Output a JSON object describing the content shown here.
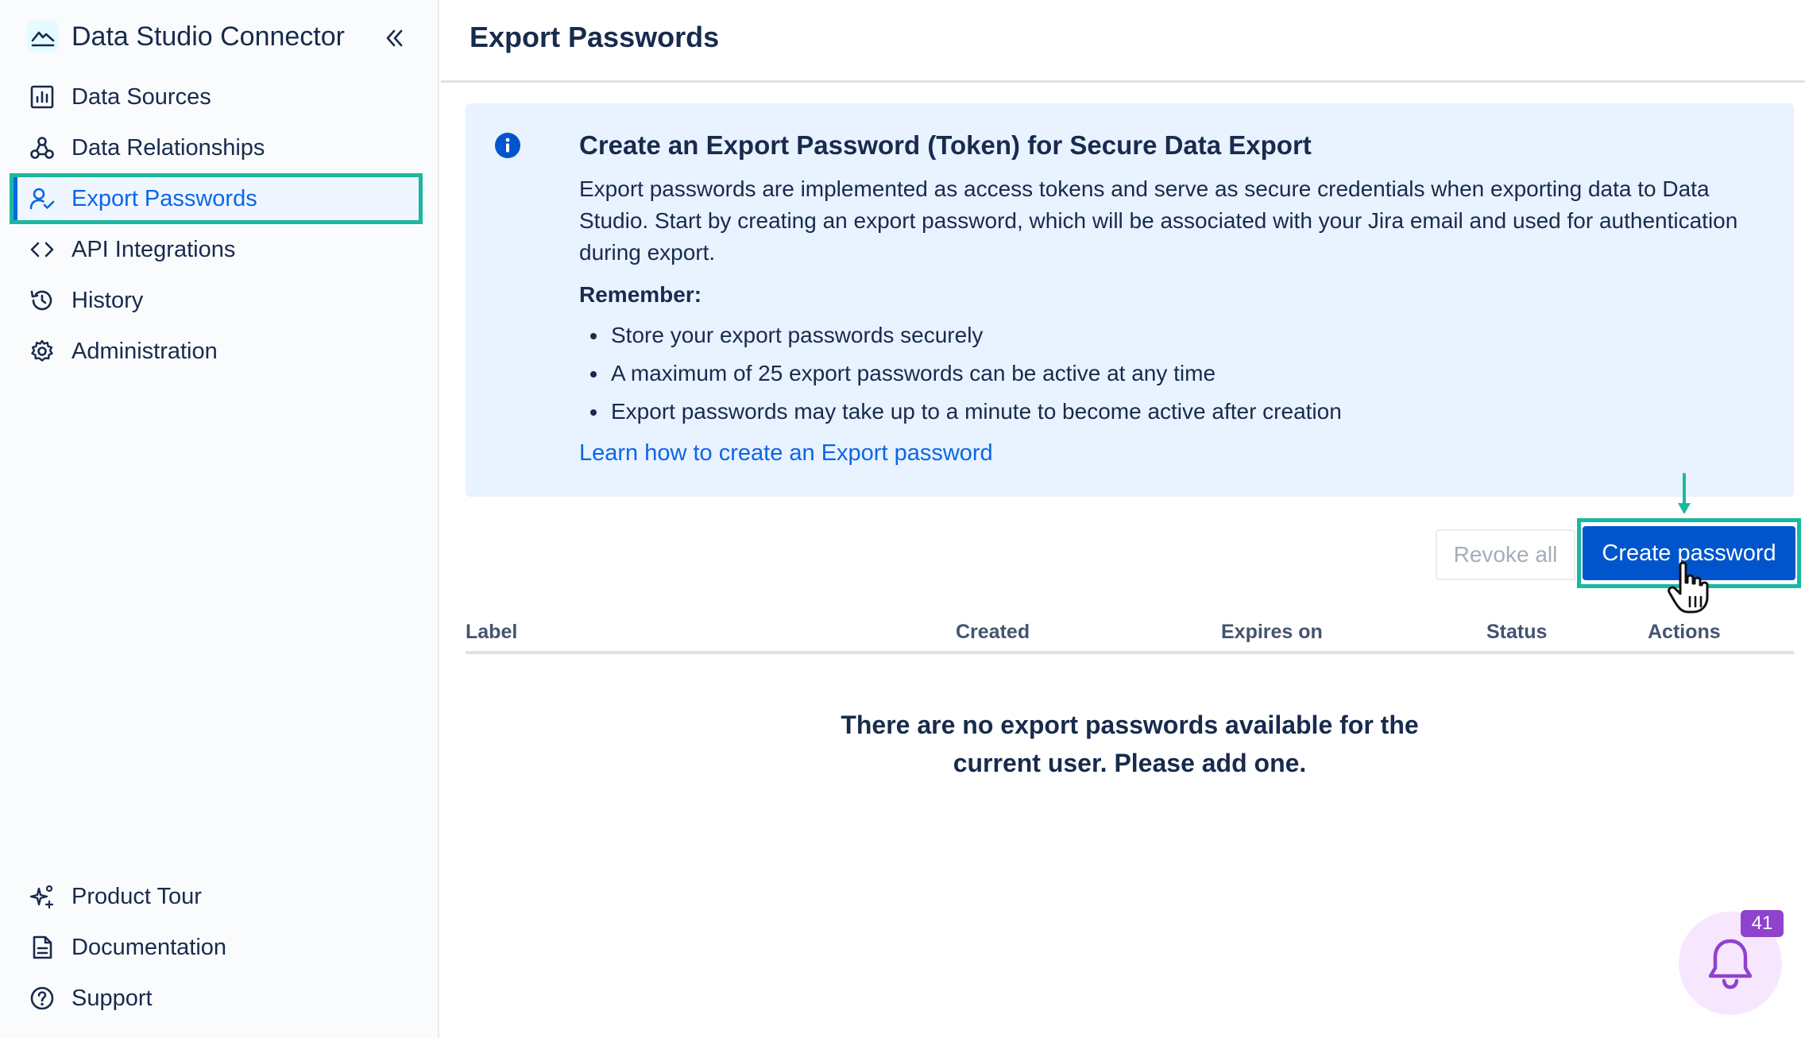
{
  "app": {
    "title": "Data Studio Connector"
  },
  "sidebar": {
    "items": [
      {
        "label": "Data Sources"
      },
      {
        "label": "Data Relationships"
      },
      {
        "label": "Export Passwords"
      },
      {
        "label": "API Integrations"
      },
      {
        "label": "History"
      },
      {
        "label": "Administration"
      }
    ],
    "bottom_items": [
      {
        "label": "Product Tour"
      },
      {
        "label": "Documentation"
      },
      {
        "label": "Support"
      }
    ]
  },
  "page": {
    "title": "Export Passwords"
  },
  "info": {
    "title": "Create an Export Password (Token) for Secure Data Export",
    "description": "Export passwords are implemented as access tokens and serve as secure credentials when exporting data to Data Studio. Start by creating an export password, which will be associated with your Jira email and used for authentication during export.",
    "remember_heading": "Remember:",
    "bullets": [
      "Store your export passwords securely",
      "A maximum of 25 export passwords can be active at any time",
      "Export passwords may take up to a minute to become active after creation"
    ],
    "link_text": "Learn how to create an Export password"
  },
  "actions": {
    "revoke_all_label": "Revoke all",
    "create_label": "Create password"
  },
  "table": {
    "columns": [
      "Label",
      "Created",
      "Expires on",
      "Status",
      "Actions"
    ],
    "empty_message_line1": "There are no export passwords available for the",
    "empty_message_line2": "current user. Please add one."
  },
  "notifications": {
    "count": "41"
  },
  "colors": {
    "accent": "#0c66e4",
    "primary_button": "#0055cc",
    "highlight": "#1ab8a0",
    "info_background": "#e9f2ff",
    "notification_badge": "#8f43cc"
  }
}
